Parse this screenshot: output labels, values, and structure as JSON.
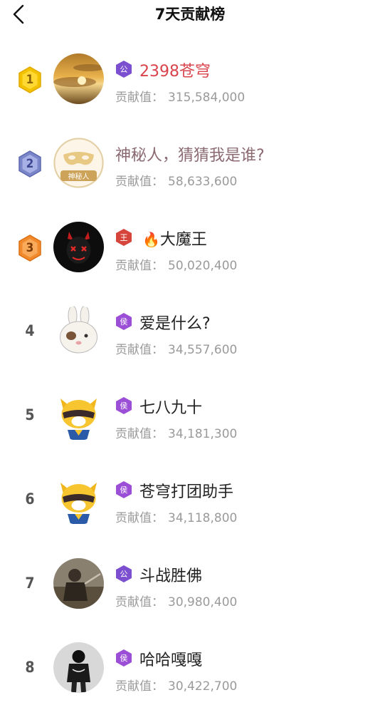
{
  "header": {
    "title": "7天贡献榜",
    "back_icon": "chevron-left-icon"
  },
  "contrib_label": "贡献值：",
  "entries": [
    {
      "rank": "1",
      "badge": "gold",
      "title_badge": "公",
      "badge_color": "#7b4fd0",
      "name": "2398苍穹",
      "value": "315,584,000",
      "avatar": "sunset-clouds"
    },
    {
      "rank": "2",
      "badge": "silver",
      "title_badge": "",
      "name": "神秘人，猜猜我是谁?",
      "value": "58,633,600",
      "avatar": "mystery-mask",
      "avatar_label": "神秘人"
    },
    {
      "rank": "3",
      "badge": "bronze",
      "title_badge": "王",
      "badge_color": "#d6453b",
      "name_prefix_icon": "fire-icon",
      "name": "大魔王",
      "value": "50,020,400",
      "avatar": "devil-face"
    },
    {
      "rank": "4",
      "badge": "plain",
      "title_badge": "侯",
      "badge_color": "#9b4fd6",
      "name": "爱是什么?",
      "value": "34,557,600",
      "avatar": "white-rabbit"
    },
    {
      "rank": "5",
      "badge": "plain",
      "title_badge": "侯",
      "badge_color": "#9b4fd6",
      "name": "七八九十",
      "value": "34,181,300",
      "avatar": "raccoon-mascot"
    },
    {
      "rank": "6",
      "badge": "plain",
      "title_badge": "侯",
      "badge_color": "#9b4fd6",
      "name": "苍穹打团助手",
      "value": "34,118,800",
      "avatar": "raccoon-mascot"
    },
    {
      "rank": "7",
      "badge": "plain",
      "title_badge": "公",
      "badge_color": "#7b4fd0",
      "name": "斗战胜佛",
      "value": "30,980,400",
      "avatar": "warrior-photo"
    },
    {
      "rank": "8",
      "badge": "plain",
      "title_badge": "侯",
      "badge_color": "#9b4fd6",
      "name": "哈哈嘎嘎",
      "value": "30,422,700",
      "avatar": "hoodie-person"
    }
  ]
}
